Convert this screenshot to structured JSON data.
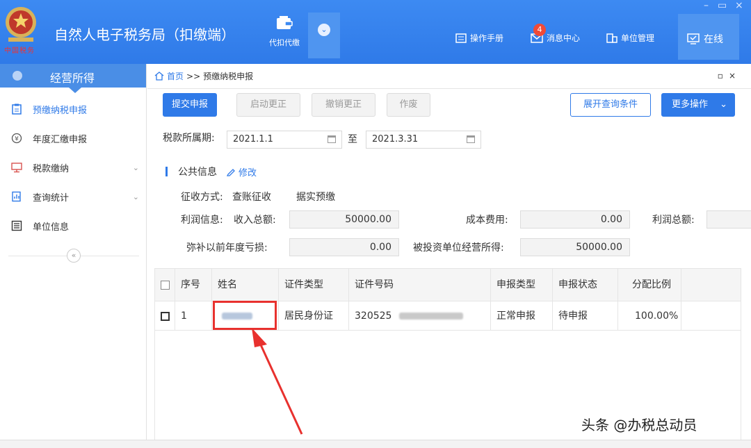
{
  "header": {
    "app_title": "自然人电子税务局（扣缴端）",
    "emblem_text": "中国税务",
    "withhold_label": "代扣代缴",
    "manual_label": "操作手册",
    "messages_label": "消息中心",
    "messages_count": "4",
    "unit_mgmt_label": "单位管理",
    "online_label": "在线",
    "colors": {
      "brand": "#2f7ae8",
      "badge": "#f04a37"
    }
  },
  "sidebar": {
    "title": "经营所得",
    "items": [
      {
        "label": "预缴纳税申报",
        "icon": "form-icon",
        "active": true
      },
      {
        "label": "年度汇缴申报",
        "icon": "coin-icon"
      },
      {
        "label": "税款缴纳",
        "icon": "monitor-icon",
        "expandable": true
      },
      {
        "label": "查询统计",
        "icon": "chart-doc-icon",
        "expandable": true
      },
      {
        "label": "单位信息",
        "icon": "list-icon"
      }
    ],
    "collapse_icon": "«"
  },
  "breadcrumb": {
    "home": "首页",
    "separator": ">>",
    "current": "预缴纳税申报"
  },
  "toolbar": {
    "submit": "提交申报",
    "start_correct": "启动更正",
    "cancel_correct": "撤销更正",
    "void": "作废",
    "expand_query": "展开查询条件",
    "more_ops": "更多操作"
  },
  "period": {
    "label": "税款所属期:",
    "start": "2021.1.1",
    "to": "至",
    "end": "2021.3.31"
  },
  "public_info": {
    "title": "公共信息",
    "edit": "修改",
    "collection_label": "征收方式:",
    "collection_value1": "查账征收",
    "collection_value2": "据实预缴",
    "profit_label": "利润信息:",
    "income_label": "收入总额:",
    "income_value": "50000.00",
    "cost_label": "成本费用:",
    "cost_value": "0.00",
    "profit_total_label": "利润总额:",
    "loss_label": "弥补以前年度亏损:",
    "loss_value": "0.00",
    "invested_label": "被投资单位经营所得:",
    "invested_value": "50000.00"
  },
  "table": {
    "headers": [
      "序号",
      "姓名",
      "证件类型",
      "证件号码",
      "申报类型",
      "申报状态",
      "分配比例"
    ],
    "rows": [
      {
        "index": "1",
        "id_type": "居民身份证",
        "id_prefix": "320525",
        "decl_type": "正常申报",
        "decl_status": "待申报",
        "ratio": "100.00%"
      }
    ]
  },
  "watermark": "头条 @办税总动员"
}
